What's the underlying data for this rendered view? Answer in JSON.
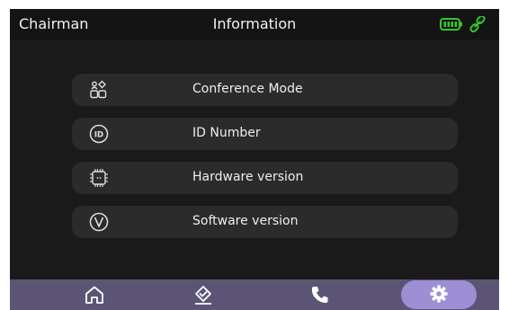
{
  "header": {
    "left_title": "Chairman",
    "title": "Information",
    "status_icons": [
      "battery-icon",
      "link-icon"
    ],
    "accent_color": "#34c82a"
  },
  "menu": {
    "items": [
      {
        "label": "Conference Mode",
        "icon": "conference-mode-icon"
      },
      {
        "label": "ID Number",
        "icon": "id-icon"
      },
      {
        "label": "Hardware version",
        "icon": "chip-icon"
      },
      {
        "label": "Software version",
        "icon": "version-icon"
      }
    ]
  },
  "navbar": {
    "items": [
      {
        "icon": "home-icon",
        "active": false
      },
      {
        "icon": "vote-icon",
        "active": false
      },
      {
        "icon": "phone-icon",
        "active": false
      },
      {
        "icon": "settings-icon",
        "active": true
      }
    ],
    "active_color": "#9d8ed6",
    "bar_color": "#5c5475"
  }
}
